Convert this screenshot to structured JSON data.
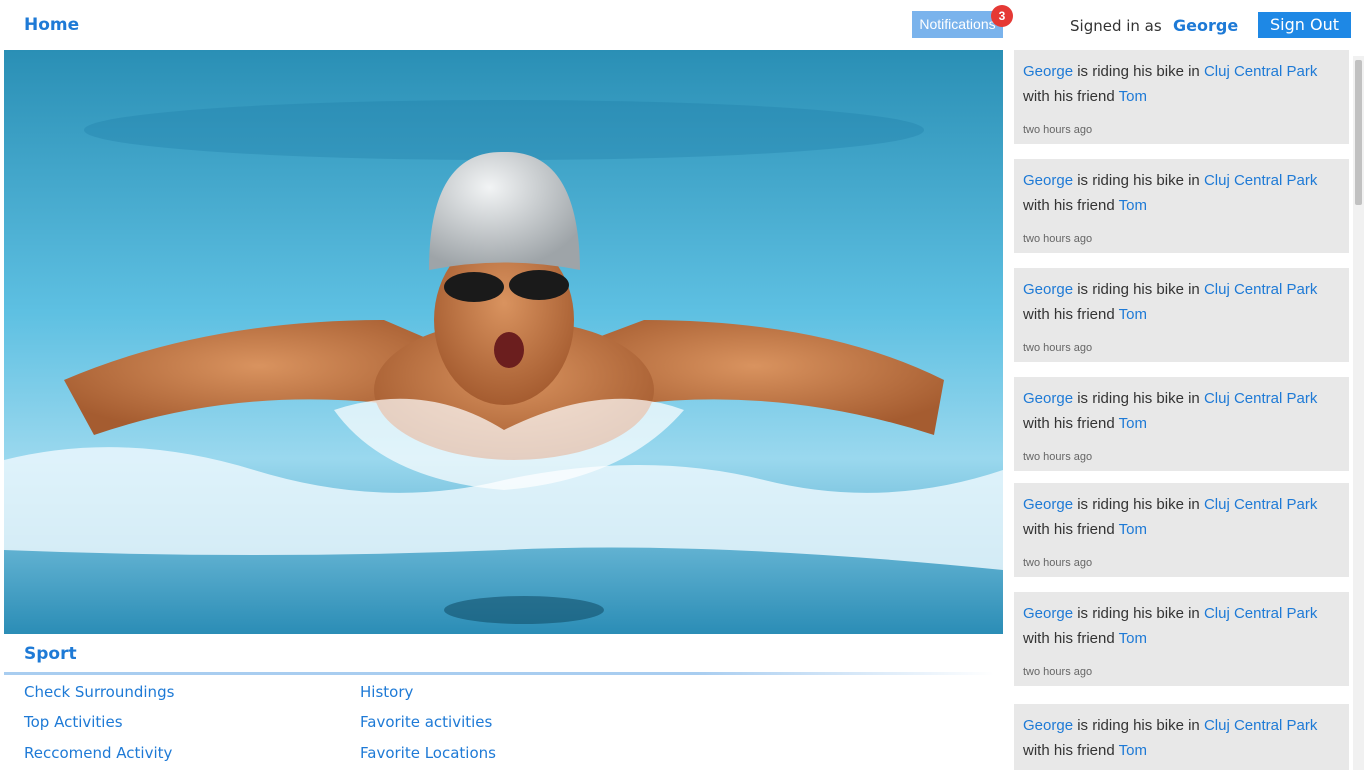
{
  "header": {
    "home_label": "Home",
    "notifications_label": "Notifications",
    "notifications_count": "3",
    "signed_in_prefix": "Signed in as",
    "username": "George",
    "sign_out_label": "Sign Out"
  },
  "hero": {
    "subject": "swimmer-photo"
  },
  "sport": {
    "title": "Sport",
    "links_col1": [
      "Check Surroundings",
      "Top Activities",
      "Reccomend Activity"
    ],
    "links_col2": [
      "History",
      "Favorite activities",
      "Favorite Locations"
    ]
  },
  "feed": {
    "items": [
      {
        "user": "George",
        "verb": "is riding his bike in",
        "place": "Cluj Central Park",
        "with": "with his friend",
        "friend": "Tom",
        "time": "two hours ago"
      },
      {
        "user": "George",
        "verb": "is riding his bike in",
        "place": "Cluj Central Park",
        "with": "with his friend",
        "friend": "Tom",
        "time": "two hours ago"
      },
      {
        "user": "George",
        "verb": "is riding his bike in",
        "place": "Cluj Central Park",
        "with": "with his friend",
        "friend": "Tom",
        "time": "two hours ago"
      },
      {
        "user": "George",
        "verb": "is riding his bike in",
        "place": "Cluj Central Park",
        "with": "with his friend",
        "friend": "Tom",
        "time": "two hours ago"
      },
      {
        "user": "George",
        "verb": "is riding his bike in",
        "place": "Cluj Central Park",
        "with": "with his friend",
        "friend": "Tom",
        "time": "two hours ago"
      },
      {
        "user": "George",
        "verb": "is riding his bike in",
        "place": "Cluj Central Park",
        "with": "with his friend",
        "friend": "Tom",
        "time": "two hours ago"
      },
      {
        "user": "George",
        "verb": "is riding his bike in",
        "place": "Cluj Central Park",
        "with": "with his friend",
        "friend": "Tom",
        "time": ""
      }
    ]
  },
  "colors": {
    "accent": "#1e7ad6",
    "button": "#1e88e5",
    "notification_bg": "#7ab3ec",
    "badge": "#e53935",
    "card_bg": "#e8e8e8"
  }
}
